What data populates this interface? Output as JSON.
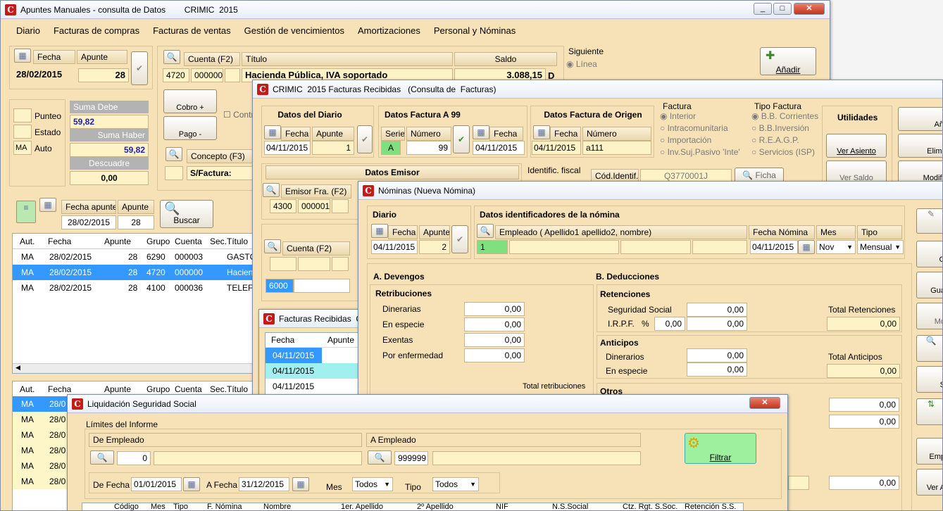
{
  "w1": {
    "title": "Apuntes Manuales - consulta de Datos        CRIMIC  2015",
    "menu": [
      "Diario",
      "Facturas de compras",
      "Facturas de ventas",
      "Gestión de vencimientos",
      "Amortizaciones",
      "Personal y Nóminas"
    ],
    "fecha_label": "Fecha",
    "apunte_label": "Apunte",
    "fecha": "28/02/2015",
    "apunte": "28",
    "cuenta_label": "Cuenta (F2)",
    "titulo_label": "Título",
    "saldo_label": "Saldo",
    "cuenta_grupo": "4720",
    "cuenta_num": "000000",
    "cuenta_titulo": "Hacienda Pública, IVA soportado",
    "saldo": "3.088,15",
    "saldo_dh": "D",
    "siguiente_label": "Siguiente",
    "linea_label": "Línea",
    "apunte_opt": "Apunte",
    "cobro": "Cobro  +",
    "pago": "Pago  -",
    "contra": "Contr",
    "punteo": "Punteo",
    "estado": "Estado",
    "auto": "Auto",
    "auto_val": "MA",
    "suma_debe_label": "Suma Debe",
    "suma_debe": "59,82",
    "suma_haber_label": "Suma Haber",
    "suma_haber": "59,82",
    "descuadre_label": "Descuadre",
    "descuadre": "0,00",
    "concepto_label": "Concepto (F3)",
    "concepto": "S/Factura:",
    "fecha_apunte_label": "Fecha apunte",
    "fecha_apunte": "28/02/2015",
    "apunte2_label": "Apunte",
    "apunte2": "28",
    "buscar": "Buscar",
    "cols": [
      "Aut.",
      "Fecha",
      "Apunte",
      "Grupo",
      "Cuenta",
      "Sec.",
      "Título"
    ],
    "rows": [
      [
        "MA",
        "28/02/2015",
        "28",
        "6290",
        "000003",
        "",
        "GASTC"
      ],
      [
        "MA",
        "28/02/2015",
        "28",
        "4720",
        "000000",
        "",
        "Hacien"
      ],
      [
        "MA",
        "28/02/2015",
        "28",
        "4100",
        "000036",
        "",
        "TELEFC"
      ]
    ],
    "rows2": [
      [
        "MA",
        "28/0"
      ],
      [
        "MA",
        "28/0"
      ],
      [
        "MA",
        "28/0"
      ],
      [
        "MA",
        "28/0"
      ],
      [
        "MA",
        "28/0"
      ],
      [
        "MA",
        "28/0"
      ]
    ],
    "right_btns": [
      "Añadir"
    ]
  },
  "w2": {
    "title": "CRIMIC  2015 Facturas Recibidas   (Consulta de  Facturas)",
    "datos_diario": "Datos del Diario",
    "fecha_label": "Fecha",
    "apunte_label": "Apunte",
    "fecha": "04/11/2015",
    "apunte": "1",
    "datos_factura": "Datos Factura A 99",
    "serie_label": "Serie",
    "numero_label": "Número",
    "serie": "A",
    "numero": "99",
    "ffecha": "04/11/2015",
    "datos_origen": "Datos Factura de Origen",
    "ofecha": "04/11/2015",
    "onum": "a111",
    "factura_label": "Factura",
    "factura_opts": [
      "Interior",
      "Intracomunitaria",
      "Importación",
      "Inv.Suj.Pasivo 'Inte'"
    ],
    "tipo_label": "Tipo Factura",
    "tipo_opts": [
      "B.B. Corrientes",
      "B.B.Inversión",
      "R.E.A.G.P.",
      "Servicios (ISP)"
    ],
    "utilidades": "Utilidades",
    "ver_asiento": "Ver Asiento",
    "ver_saldo": "Ver Saldo",
    "datos_emisor": "Datos Emisor",
    "identif": "Identific. fiscal",
    "cod_identif": "Cód.Identif.",
    "cif": "Q3770001J",
    "ficha": "Ficha",
    "emisor_label": "Emisor  Fra. (F2)",
    "emisor_g": "4300",
    "emisor_n": "000001",
    "cuenta_label": "Cuenta (F2)",
    "cuenta_val": "6000",
    "right": [
      "Añ",
      "Elimi",
      "Modifi"
    ]
  },
  "w3": {
    "title": "Facturas Recibidas  C",
    "cols": [
      "Fecha",
      "Apunte"
    ],
    "rows": [
      "04/11/2015",
      "04/11/2015",
      "04/11/2015"
    ]
  },
  "w4": {
    "title": "Nóminas (Nueva Nómina)",
    "diario": "Diario",
    "datos_id": "Datos identificadores de la nómina",
    "fecha_label": "Fecha",
    "apunte_label": "Apunte",
    "fecha": "04/11/2015",
    "apunte": "2",
    "empleado_label": "Empleado ( Apellido1 apellido2,  nombre)",
    "empleado": "1",
    "fecha_nomina_label": "Fecha Nómina",
    "fecha_nomina": "04/11/2015",
    "mes_label": "Mes",
    "mes": "Nov",
    "tipo_label": "Tipo",
    "tipo": "Mensual",
    "devengos": "A. Devengos",
    "deducciones": "B. Deducciones",
    "retribuciones": "Retribuciones",
    "retr_items": [
      [
        "Dinerarias",
        "0,00"
      ],
      [
        "En especie",
        "0,00"
      ],
      [
        "Exentas",
        "0,00"
      ],
      [
        "Por enfermedad",
        "0,00"
      ]
    ],
    "total_retr": "Total retribuciones",
    "retenciones": "Retenciones",
    "ss_label": "Seguridad Social",
    "ss": "0,00",
    "irpf_label": "I.R.P.F.",
    "pct": "%",
    "irpf_pct": "0,00",
    "irpf": "0,00",
    "total_ret_label": "Total Retenciones",
    "total_ret": "0,00",
    "anticipos": "Anticipos",
    "din_label": "Dinerarios",
    "din": "0,00",
    "esp_label": "En especie",
    "esp": "0,00",
    "total_ant_label": "Total Anticipos",
    "total_ant": "0,00",
    "otros": "Otros",
    "otros_vals": [
      "0,00",
      "0,00",
      "0,00"
    ],
    "right": [
      "",
      "G",
      "Gua",
      "Mo",
      "",
      "S",
      "",
      "Emp",
      "Ver A"
    ]
  },
  "w5": {
    "title": "Liquidación Seguridad Social",
    "limites": "Límites del Informe",
    "de_emp": "De Empleado",
    "a_emp": "A Empleado",
    "de_val": "0",
    "a_val": "999999",
    "filtrar": "Filtrar",
    "de_fecha": "De Fecha",
    "de_fecha_val": "01/01/2015",
    "a_fecha": "A Fecha",
    "a_fecha_val": "31/12/2015",
    "mes": "Mes",
    "mes_val": "Todos",
    "tipo": "Tipo",
    "tipo_val": "Todos",
    "cols": [
      "Código",
      "Mes",
      "Tipo",
      "F. Nómina",
      "Nombre",
      "1er. Apellido",
      "2º Apellido",
      "NIF",
      "N.S.Social",
      "Ctz. Rgt. S.Soc.",
      "Retención S.S."
    ]
  }
}
